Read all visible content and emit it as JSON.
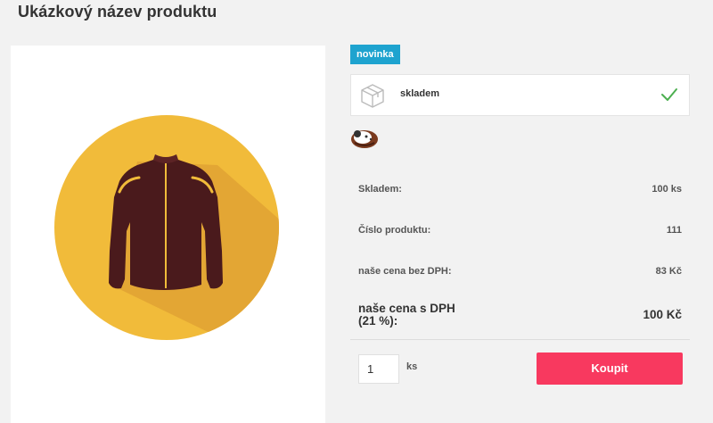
{
  "product": {
    "title": "Ukázkový název produktu",
    "flag": "novinka",
    "availability": "skladem"
  },
  "params": [
    {
      "label": "Skladem:",
      "value": "100 ks"
    },
    {
      "label": "Číslo produktu:",
      "value": "111"
    },
    {
      "label": "naše cena bez DPH:",
      "value": "83 Kč"
    },
    {
      "label": "naše cena s DPH (21 %):",
      "value": "100 Kč"
    }
  ],
  "cart": {
    "quantity": "1",
    "unit": "ks",
    "buy_label": "Koupit"
  },
  "icons": {
    "product_image": "jacket-illustration",
    "availability": "package-box-icon",
    "availability_status": "check-icon",
    "brand": "brand-logo"
  },
  "colors": {
    "flag": "#1ea3cf",
    "buy_button": "#f8395f",
    "check": "#4caf50",
    "circle": "#f1bb3a"
  }
}
